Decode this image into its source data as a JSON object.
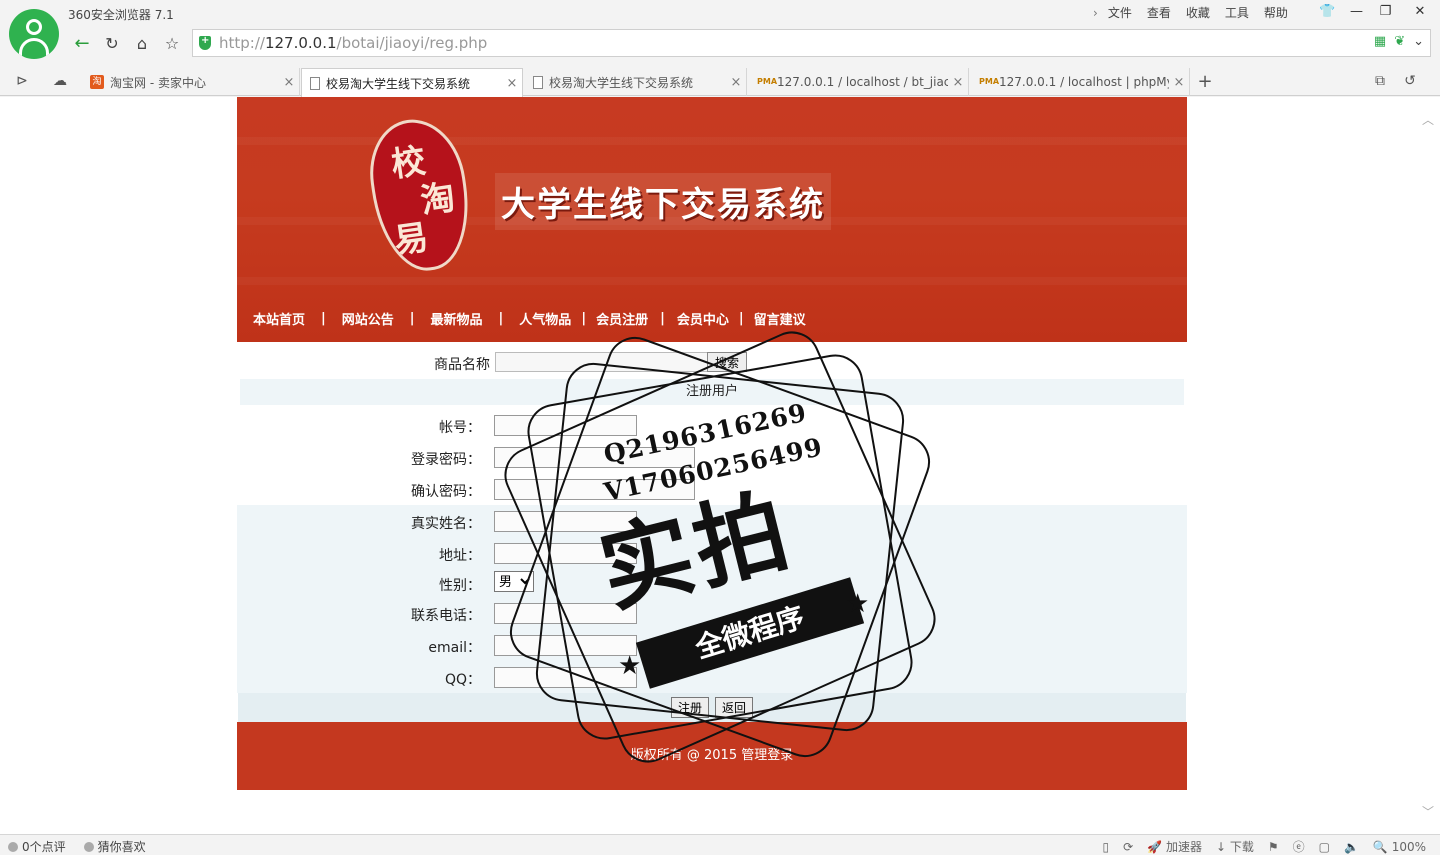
{
  "browser": {
    "app_title": "360安全浏览器 7.1",
    "menu": [
      "文件",
      "查看",
      "收藏",
      "工具",
      "帮助"
    ],
    "url_scheme": "http://",
    "url_host": "127.0.0.1",
    "url_path": "/botai/jiaoyi/reg.php",
    "tabs": [
      {
        "label": "淘宝网 - 卖家中心",
        "icon": "taobao-icon"
      },
      {
        "label": "校易淘大学生线下交易系统",
        "icon": "page-icon"
      },
      {
        "label": "校易淘大学生线下交易系统",
        "icon": "page-icon"
      },
      {
        "label": "127.0.0.1 / localhost / bt_jiac",
        "icon": "pma-icon"
      },
      {
        "label": "127.0.0.1 / localhost | phpMy",
        "icon": "pma-icon"
      }
    ],
    "status_left": [
      "0个点评",
      "猜你喜欢"
    ],
    "status_accelerator": "加速器",
    "status_download": "下载",
    "zoom": "100%"
  },
  "site": {
    "logo_chars": [
      "校",
      "易",
      "淘"
    ],
    "title": "大学生线下交易系统",
    "nav": [
      "本站首页",
      "网站公告",
      "最新物品",
      "人气物品",
      "会员注册",
      "会员中心",
      "留言建议"
    ],
    "search_label": "商品名称",
    "search_button": "搜索",
    "form_title": "注册用户",
    "fields": {
      "account": "帐号：",
      "password": "登录密码：",
      "confirm": "确认密码：",
      "realname": "真实姓名：",
      "address": "地址：",
      "gender": "性别：",
      "phone": "联系电话：",
      "email": "email：",
      "qq": "QQ："
    },
    "gender_selected": "男",
    "register_button": "注册",
    "back_button": "返回",
    "footer": "版权所有 @ 2015 管理登录"
  },
  "watermark": {
    "line1": "Q2196316269",
    "line2": "V17060256499",
    "big": "实拍",
    "ribbon": "全微程序"
  }
}
